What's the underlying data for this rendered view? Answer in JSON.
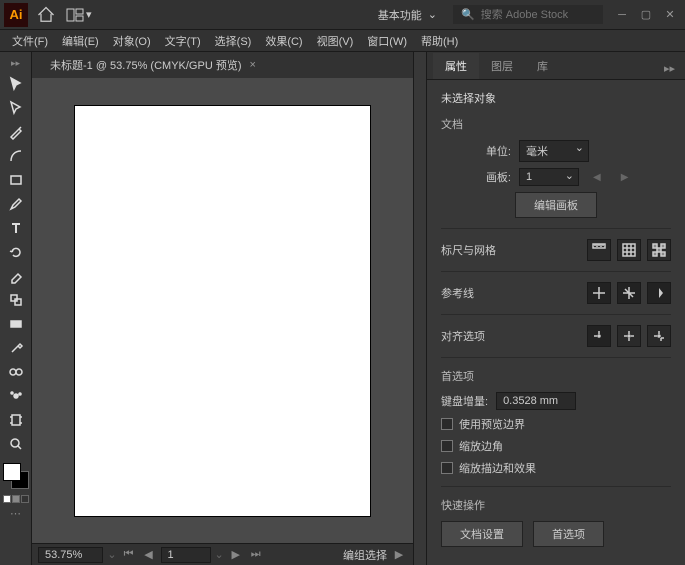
{
  "titlebar": {
    "logo": "Ai",
    "workspace": "基本功能",
    "search_placeholder": "搜索 Adobe Stock"
  },
  "menu": {
    "file": "文件(F)",
    "edit": "编辑(E)",
    "object": "对象(O)",
    "type": "文字(T)",
    "select": "选择(S)",
    "effect": "效果(C)",
    "view": "视图(V)",
    "window": "窗口(W)",
    "help": "帮助(H)"
  },
  "document": {
    "tab_title": "未标题-1 @ 53.75% (CMYK/GPU 预览)",
    "zoom": "53.75%",
    "artboard_num": "1",
    "status": "编组选择"
  },
  "panel": {
    "tabs": {
      "properties": "属性",
      "layers": "图层",
      "libraries": "库"
    },
    "no_selection": "未选择对象",
    "doc_section": "文档",
    "units_label": "单位:",
    "units_value": "毫米",
    "artboard_label": "画板:",
    "artboard_value": "1",
    "edit_artboards": "编辑画板",
    "rulers_grid": "标尺与网格",
    "guides": "参考线",
    "align_options": "对齐选项",
    "preferences": "首选项",
    "keyboard_incr_label": "键盘增量:",
    "keyboard_incr_value": "0.3528 mm",
    "use_preview_bounds": "使用预览边界",
    "scale_corners": "缩放边角",
    "scale_strokes": "缩放描边和效果",
    "quick_actions": "快速操作",
    "doc_setup": "文档设置",
    "prefs_btn": "首选项"
  }
}
